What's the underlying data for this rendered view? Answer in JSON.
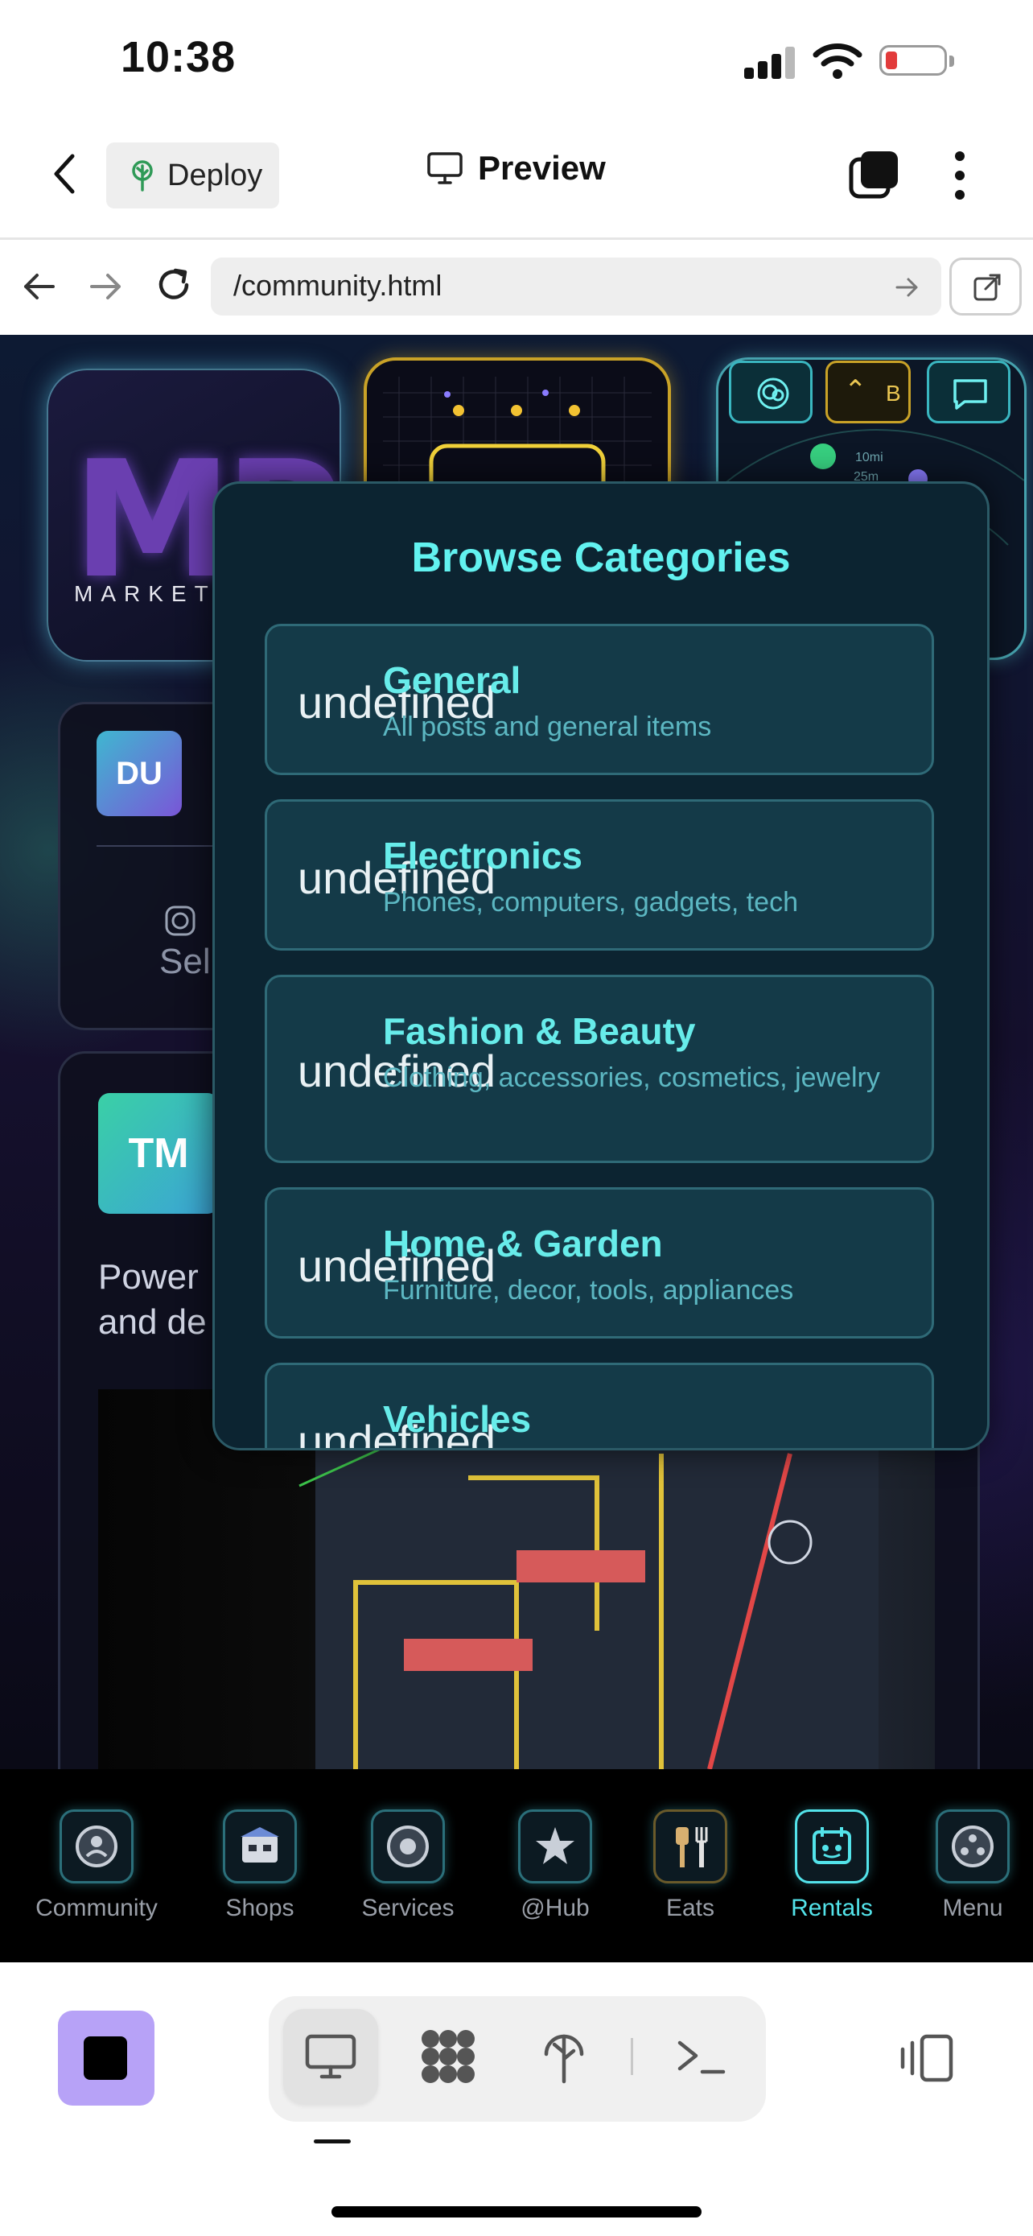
{
  "status_bar": {
    "time": "10:38",
    "battery_color": "#e23b3b"
  },
  "header": {
    "back_icon": "chevron-left-icon",
    "deploy_label": "Deploy",
    "preview_label": "Preview",
    "tabs_icon": "tabs-icon",
    "more_icon": "more-vertical-icon"
  },
  "browser": {
    "url": "/community.html"
  },
  "background": {
    "logo_word": "MARKET",
    "avatar_1": "DU",
    "avatar_2": "TM",
    "partial_text_1": "Sell",
    "partial_text_2": "Power",
    "partial_text_3": "and de",
    "chip_b": "B",
    "radius_label_1": "10mi",
    "radius_label_2": "25m"
  },
  "modal": {
    "title": "Browse Categories",
    "categories": [
      {
        "icon": "undefined",
        "name": "General",
        "description": "All posts and general items"
      },
      {
        "icon": "undefined",
        "name": "Electronics",
        "description": "Phones, computers, gadgets, tech"
      },
      {
        "icon": "undefined",
        "name": "Fashion & Beauty",
        "description": "Clothing, accessories, cosmetics, jewelry"
      },
      {
        "icon": "undefined",
        "name": "Home & Garden",
        "description": "Furniture, decor, tools, appliances"
      },
      {
        "icon": "undefined",
        "name": "Vehicles",
        "description": ""
      }
    ]
  },
  "bottom_nav": {
    "items": [
      {
        "label": "Community",
        "icon": "community-icon"
      },
      {
        "label": "Shops",
        "icon": "shop-icon"
      },
      {
        "label": "Services",
        "icon": "services-icon"
      },
      {
        "label": "@Hub",
        "icon": "star-icon"
      },
      {
        "label": "Eats",
        "icon": "utensils-icon"
      },
      {
        "label": "Rentals",
        "icon": "calendar-icon",
        "active": true
      },
      {
        "label": "Menu",
        "icon": "menu-icon"
      }
    ],
    "active_color": "#53e3ea"
  },
  "toolbar": {
    "stop_color": "#b7a2f7"
  }
}
